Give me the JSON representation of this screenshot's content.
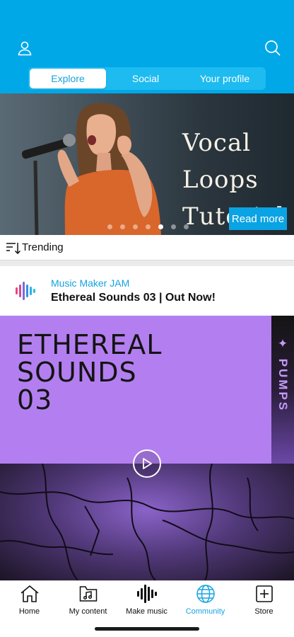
{
  "header": {
    "tabs": [
      {
        "label": "Explore",
        "active": true
      },
      {
        "label": "Social",
        "active": false
      },
      {
        "label": "Your profile",
        "active": false
      }
    ],
    "accent_color": "#00a8e8"
  },
  "banner": {
    "title_line1": "Vocal Loops",
    "title_line2": "Tutorial",
    "button_label": "Read more",
    "dots_count": 7,
    "active_dot": 5
  },
  "trending": {
    "label": "Trending",
    "icon": "sort-icon"
  },
  "post": {
    "app_name": "Music Maker JAM",
    "title": "Ethereal Sounds 03 | Out Now!",
    "art": {
      "title_line1": "ETHEREAL",
      "title_line2": "SOUNDS",
      "title_line3": "03",
      "strip_text": "✦ PUMPS",
      "color": "#b37ff0"
    }
  },
  "tabbar": {
    "items": [
      {
        "label": "Home",
        "icon": "home-icon"
      },
      {
        "label": "My content",
        "icon": "music-folder-icon"
      },
      {
        "label": "Make music",
        "icon": "waveform-icon"
      },
      {
        "label": "Community",
        "icon": "globe-icon",
        "active": true
      },
      {
        "label": "Store",
        "icon": "store-icon"
      }
    ]
  }
}
